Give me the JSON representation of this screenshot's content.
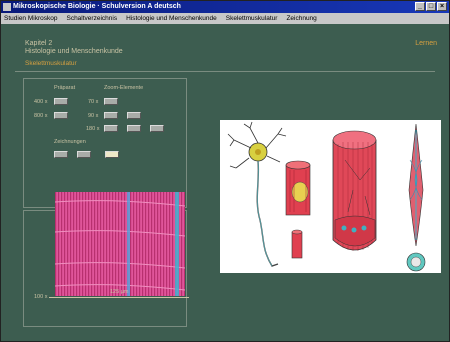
{
  "window": {
    "title": "Mikroskopische Biologie · Schulversion A deutsch",
    "buttons": [
      "_",
      "□",
      "×"
    ]
  },
  "menu": {
    "items": [
      "Studien Mikroskop",
      "Schaltverzeichnis",
      "Histologie und Menschenkunde",
      "Skelettmuskulatur",
      "Zeichnung"
    ]
  },
  "header": {
    "chapter": "Kapitel 2",
    "subject": "Histologie und Menschenkunde",
    "section": "Skelettmuskulatur",
    "learn_label": "Lernen"
  },
  "controls": {
    "praeparat_label": "Präparat",
    "zoom_label": "Zoom-Elemente",
    "zeichnungen_label": "Zeichnungen",
    "praeparat_mags": [
      "400 x",
      "800 x"
    ],
    "zoom_mags": [
      "70 x",
      "90 x",
      "180 x"
    ]
  },
  "micrograph": {
    "mag_label": "100 x",
    "scale_label": "125 µm"
  },
  "colors": {
    "background": "#3d5d50",
    "accent": "#d6a040",
    "text": "#c9c3a4"
  }
}
